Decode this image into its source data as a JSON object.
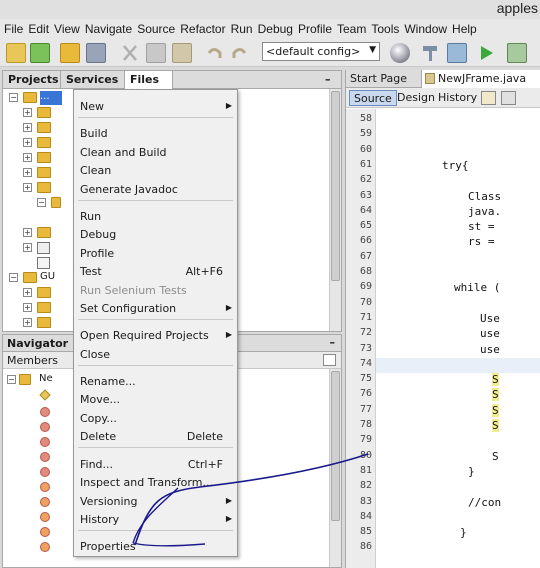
{
  "window": {
    "title": "apples"
  },
  "menubar": [
    "File",
    "Edit",
    "View",
    "Navigate",
    "Source",
    "Refactor",
    "Run",
    "Debug",
    "Profile",
    "Team",
    "Tools",
    "Window",
    "Help"
  ],
  "toolbar": {
    "config_value": "<default config>"
  },
  "left_tabs": [
    "Projects",
    "Services",
    "Files"
  ],
  "navigator": {
    "title": "Navigator",
    "members_label": "Members",
    "root_label": "Ne"
  },
  "tree": {
    "root_label": "...",
    "gui_label": "GU"
  },
  "editor": {
    "tabs": [
      "Start Page",
      "NewJFrame.java"
    ],
    "subtabs": [
      "Source",
      "Design",
      "History"
    ],
    "line_numbers": [
      "58",
      "59",
      "60",
      "61",
      "62",
      "63",
      "64",
      "65",
      "66",
      "67",
      "68",
      "69",
      "70",
      "71",
      "72",
      "73",
      "74",
      "75",
      "76",
      "77",
      "78",
      "79",
      "80",
      "81",
      "82",
      "83",
      "84",
      "85",
      "86"
    ],
    "lines": {
      "61": "try{",
      "63": "Class",
      "64": "java.",
      "65": "st =",
      "66": "rs =",
      "69": "while (",
      "71": "Use",
      "72": "use",
      "73": "use",
      "75": "S",
      "76": "S",
      "77": "S",
      "78": "S",
      "80": "S",
      "81": "}",
      "83": "//con",
      "85": "}"
    }
  },
  "context_menu": {
    "items": [
      {
        "label": "New",
        "submenu": true
      },
      {
        "label": "Build"
      },
      {
        "label": "Clean and Build"
      },
      {
        "label": "Clean"
      },
      {
        "label": "Generate Javadoc"
      },
      {
        "label": "Run"
      },
      {
        "label": "Debug"
      },
      {
        "label": "Profile"
      },
      {
        "label": "Test",
        "shortcut": "Alt+F6"
      },
      {
        "label": "Run Selenium Tests",
        "disabled": true
      },
      {
        "label": "Set Configuration",
        "submenu": true
      },
      {
        "label": "Open Required Projects",
        "submenu": true
      },
      {
        "label": "Close"
      },
      {
        "label": "Rename..."
      },
      {
        "label": "Move..."
      },
      {
        "label": "Copy..."
      },
      {
        "label": "Delete",
        "shortcut": "Delete"
      },
      {
        "label": "Find...",
        "shortcut": "Ctrl+F"
      },
      {
        "label": "Inspect and Transform..."
      },
      {
        "label": "Versioning",
        "submenu": true
      },
      {
        "label": "History",
        "submenu": true
      },
      {
        "label": "Properties"
      }
    ]
  },
  "colors": {
    "annotation": "#1a1a8c",
    "selection": "#3875d7"
  }
}
